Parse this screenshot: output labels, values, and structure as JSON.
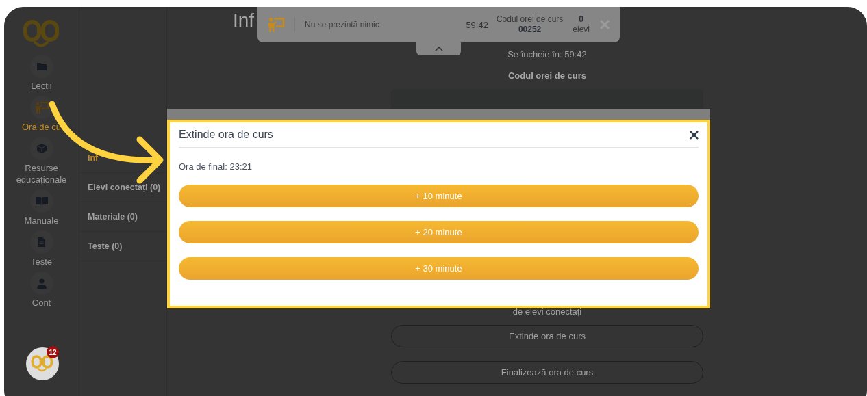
{
  "sidebar": {
    "items": [
      {
        "label": "Lecții",
        "kind": "folder",
        "selected": false
      },
      {
        "label": "Oră de cu",
        "kind": "teacher",
        "selected": true
      },
      {
        "label": "Resurse educaționale",
        "kind": "cube",
        "selected": false
      },
      {
        "label": "Manuale",
        "kind": "book",
        "selected": false
      },
      {
        "label": "Teste",
        "kind": "file",
        "selected": false
      },
      {
        "label": "Cont",
        "kind": "person",
        "selected": false
      }
    ]
  },
  "panel": {
    "items": [
      {
        "label": "Inf",
        "selected": true
      },
      {
        "label": "Elevi conectați (0)",
        "selected": false
      },
      {
        "label": "Materiale (0)",
        "selected": false
      },
      {
        "label": "Teste (0)",
        "selected": false
      }
    ]
  },
  "main": {
    "heading": "Inf",
    "ends_in": "Se încheie în: 59:42",
    "code_label": "Codul orei de curs",
    "connected_note": "de elevi conectați",
    "buttons": [
      "Extinde ora de curs",
      "Finalizează ora de curs"
    ]
  },
  "toast": {
    "status": "Nu se prezintă nimic",
    "timer": "59:42",
    "code_label": "Codul orei de curs",
    "code": "00252",
    "students_count": "0",
    "students_label": "elevi"
  },
  "modal": {
    "title": "Extinde ora de curs",
    "end_time": "Ora de final: 23:21",
    "options": [
      "+ 10 minute",
      "+ 20 minute",
      "+ 30 minute"
    ]
  },
  "chat": {
    "badge": "12"
  }
}
